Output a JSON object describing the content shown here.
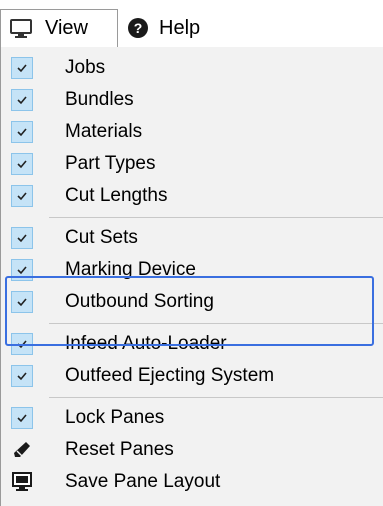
{
  "menubar": {
    "view": {
      "label": "View",
      "icon": "monitor-icon"
    },
    "help": {
      "label": "Help",
      "icon": "help-circle-icon"
    }
  },
  "menu": {
    "items": [
      {
        "label": "Jobs",
        "checked": true
      },
      {
        "label": "Bundles",
        "checked": true
      },
      {
        "label": "Materials",
        "checked": true
      },
      {
        "label": "Part Types",
        "checked": true
      },
      {
        "label": "Cut Lengths",
        "checked": true
      },
      {
        "label": "Cut Sets",
        "checked": true
      },
      {
        "label": "Marking Device",
        "checked": true
      },
      {
        "label": "Outbound Sorting",
        "checked": true
      },
      {
        "label": "Infeed Auto-Loader",
        "checked": true
      },
      {
        "label": "Outfeed Ejecting System",
        "checked": true
      },
      {
        "label": "Lock Panes",
        "checked": true
      },
      {
        "label": "Reset Panes",
        "icon": "eraser-icon"
      },
      {
        "label": "Save Pane Layout",
        "icon": "monitor-save-icon"
      }
    ]
  },
  "colors": {
    "check_bg": "#c5e3f7",
    "check_border": "#8cc4ea",
    "highlight_border": "#3a6fe0",
    "menu_bg": "#f2f2f2"
  }
}
